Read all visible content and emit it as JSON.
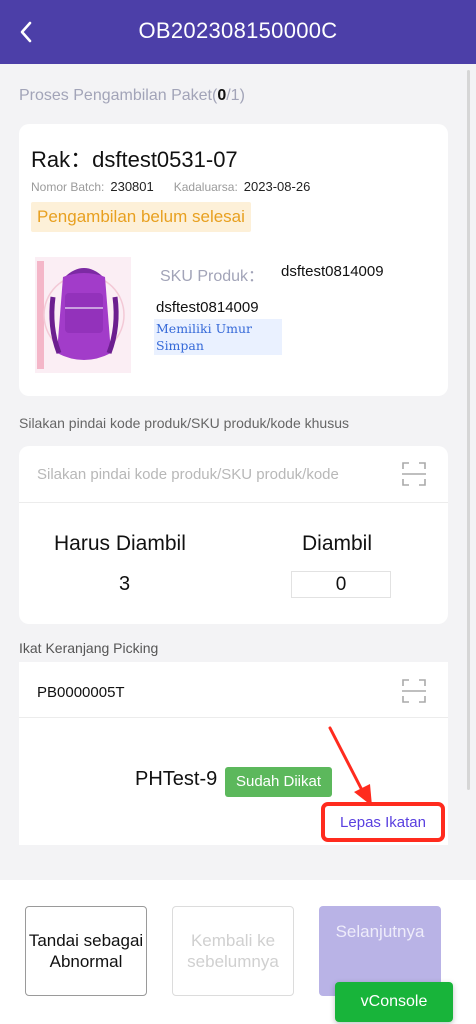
{
  "header": {
    "title": "OB202308150000C",
    "back_icon": "chevron-left-icon"
  },
  "progress": {
    "label_prefix": "Proses Pengambilan Paket(",
    "done": "0",
    "label_suffix": "/1)"
  },
  "rack": {
    "title": "Rak：dsftest0531-07",
    "batch_label": "Nomor Batch:",
    "batch_value": "230801",
    "expiry_label": "Kadaluarsa:",
    "expiry_value": "2023-08-26",
    "status": "Pengambilan belum selesai",
    "status_color": "#e8a020"
  },
  "product": {
    "image_icon": "backpack-image",
    "sku_label": "SKU Produk：",
    "sku_value": "dsftest0814009",
    "name": "dsftest0814009",
    "shelf_life_tag": "Memiliki Umur Simpan"
  },
  "scan": {
    "instruction": "Silakan pindai kode produk/SKU produk/kode khusus",
    "placeholder": "Silakan pindai kode produk/SKU produk/kode",
    "scan_icon": "scan-frame-icon",
    "must_pick_label": "Harus Diambil",
    "must_pick_value": "3",
    "picked_label": "Diambil",
    "picked_value": "0"
  },
  "basket": {
    "section_label": "Ikat Keranjang Picking",
    "code": "PB0000005T",
    "name": "PHTest-9",
    "bound_badge": "Sudah Diikat",
    "release_button": "Lepas Ikatan",
    "highlight_color": "#ff2b1e"
  },
  "footer": {
    "abnormal_button": "Tandai sebagai Abnormal",
    "previous_button": "Kembali ke sebelumnya",
    "next_button": "Selanjutnya"
  },
  "vconsole": {
    "label": "vConsole"
  },
  "colors": {
    "brand": "#4c3fa8",
    "success": "#5cb85c",
    "link": "#5a40e0"
  }
}
